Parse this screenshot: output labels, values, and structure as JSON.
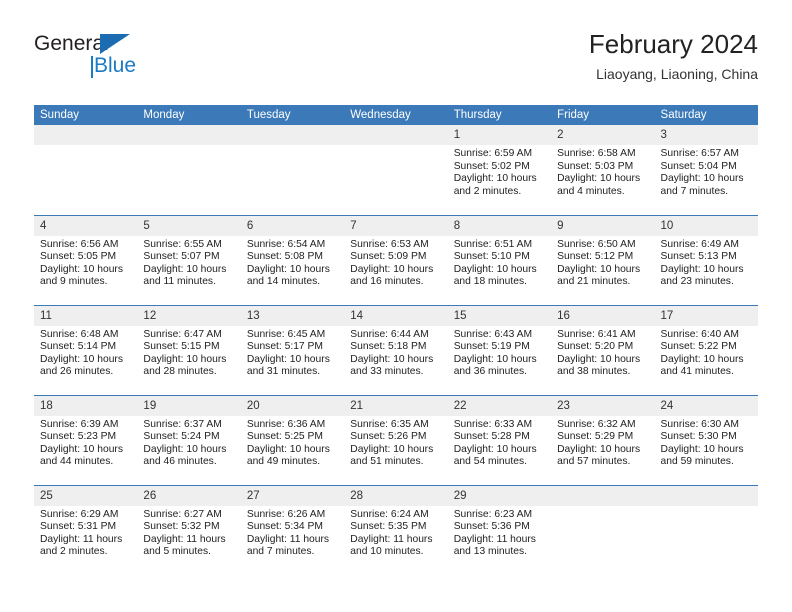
{
  "brand": {
    "name_part1": "General",
    "name_part2": "Blue"
  },
  "header": {
    "title": "February 2024",
    "subtitle": "Liaoyang, Liaoning, China"
  },
  "weekday_headers": [
    "Sunday",
    "Monday",
    "Tuesday",
    "Wednesday",
    "Thursday",
    "Friday",
    "Saturday"
  ],
  "colors": {
    "header_blue": "#3b79b8",
    "day_band_gray": "#efefef",
    "logo_blue": "#1b7cc4",
    "text_dark": "#222222"
  },
  "labels": {
    "sunrise_prefix": "Sunrise:",
    "sunset_prefix": "Sunset:",
    "daylight_prefix": "Daylight:"
  },
  "weeks": [
    [
      {
        "day": "",
        "empty": true
      },
      {
        "day": "",
        "empty": true
      },
      {
        "day": "",
        "empty": true
      },
      {
        "day": "",
        "empty": true
      },
      {
        "day": "1",
        "sunrise": "Sunrise: 6:59 AM",
        "sunset": "Sunset: 5:02 PM",
        "daylight": "Daylight: 10 hours and 2 minutes."
      },
      {
        "day": "2",
        "sunrise": "Sunrise: 6:58 AM",
        "sunset": "Sunset: 5:03 PM",
        "daylight": "Daylight: 10 hours and 4 minutes."
      },
      {
        "day": "3",
        "sunrise": "Sunrise: 6:57 AM",
        "sunset": "Sunset: 5:04 PM",
        "daylight": "Daylight: 10 hours and 7 minutes."
      }
    ],
    [
      {
        "day": "4",
        "sunrise": "Sunrise: 6:56 AM",
        "sunset": "Sunset: 5:05 PM",
        "daylight": "Daylight: 10 hours and 9 minutes."
      },
      {
        "day": "5",
        "sunrise": "Sunrise: 6:55 AM",
        "sunset": "Sunset: 5:07 PM",
        "daylight": "Daylight: 10 hours and 11 minutes."
      },
      {
        "day": "6",
        "sunrise": "Sunrise: 6:54 AM",
        "sunset": "Sunset: 5:08 PM",
        "daylight": "Daylight: 10 hours and 14 minutes."
      },
      {
        "day": "7",
        "sunrise": "Sunrise: 6:53 AM",
        "sunset": "Sunset: 5:09 PM",
        "daylight": "Daylight: 10 hours and 16 minutes."
      },
      {
        "day": "8",
        "sunrise": "Sunrise: 6:51 AM",
        "sunset": "Sunset: 5:10 PM",
        "daylight": "Daylight: 10 hours and 18 minutes."
      },
      {
        "day": "9",
        "sunrise": "Sunrise: 6:50 AM",
        "sunset": "Sunset: 5:12 PM",
        "daylight": "Daylight: 10 hours and 21 minutes."
      },
      {
        "day": "10",
        "sunrise": "Sunrise: 6:49 AM",
        "sunset": "Sunset: 5:13 PM",
        "daylight": "Daylight: 10 hours and 23 minutes."
      }
    ],
    [
      {
        "day": "11",
        "sunrise": "Sunrise: 6:48 AM",
        "sunset": "Sunset: 5:14 PM",
        "daylight": "Daylight: 10 hours and 26 minutes."
      },
      {
        "day": "12",
        "sunrise": "Sunrise: 6:47 AM",
        "sunset": "Sunset: 5:15 PM",
        "daylight": "Daylight: 10 hours and 28 minutes."
      },
      {
        "day": "13",
        "sunrise": "Sunrise: 6:45 AM",
        "sunset": "Sunset: 5:17 PM",
        "daylight": "Daylight: 10 hours and 31 minutes."
      },
      {
        "day": "14",
        "sunrise": "Sunrise: 6:44 AM",
        "sunset": "Sunset: 5:18 PM",
        "daylight": "Daylight: 10 hours and 33 minutes."
      },
      {
        "day": "15",
        "sunrise": "Sunrise: 6:43 AM",
        "sunset": "Sunset: 5:19 PM",
        "daylight": "Daylight: 10 hours and 36 minutes."
      },
      {
        "day": "16",
        "sunrise": "Sunrise: 6:41 AM",
        "sunset": "Sunset: 5:20 PM",
        "daylight": "Daylight: 10 hours and 38 minutes."
      },
      {
        "day": "17",
        "sunrise": "Sunrise: 6:40 AM",
        "sunset": "Sunset: 5:22 PM",
        "daylight": "Daylight: 10 hours and 41 minutes."
      }
    ],
    [
      {
        "day": "18",
        "sunrise": "Sunrise: 6:39 AM",
        "sunset": "Sunset: 5:23 PM",
        "daylight": "Daylight: 10 hours and 44 minutes."
      },
      {
        "day": "19",
        "sunrise": "Sunrise: 6:37 AM",
        "sunset": "Sunset: 5:24 PM",
        "daylight": "Daylight: 10 hours and 46 minutes."
      },
      {
        "day": "20",
        "sunrise": "Sunrise: 6:36 AM",
        "sunset": "Sunset: 5:25 PM",
        "daylight": "Daylight: 10 hours and 49 minutes."
      },
      {
        "day": "21",
        "sunrise": "Sunrise: 6:35 AM",
        "sunset": "Sunset: 5:26 PM",
        "daylight": "Daylight: 10 hours and 51 minutes."
      },
      {
        "day": "22",
        "sunrise": "Sunrise: 6:33 AM",
        "sunset": "Sunset: 5:28 PM",
        "daylight": "Daylight: 10 hours and 54 minutes."
      },
      {
        "day": "23",
        "sunrise": "Sunrise: 6:32 AM",
        "sunset": "Sunset: 5:29 PM",
        "daylight": "Daylight: 10 hours and 57 minutes."
      },
      {
        "day": "24",
        "sunrise": "Sunrise: 6:30 AM",
        "sunset": "Sunset: 5:30 PM",
        "daylight": "Daylight: 10 hours and 59 minutes."
      }
    ],
    [
      {
        "day": "25",
        "sunrise": "Sunrise: 6:29 AM",
        "sunset": "Sunset: 5:31 PM",
        "daylight": "Daylight: 11 hours and 2 minutes."
      },
      {
        "day": "26",
        "sunrise": "Sunrise: 6:27 AM",
        "sunset": "Sunset: 5:32 PM",
        "daylight": "Daylight: 11 hours and 5 minutes."
      },
      {
        "day": "27",
        "sunrise": "Sunrise: 6:26 AM",
        "sunset": "Sunset: 5:34 PM",
        "daylight": "Daylight: 11 hours and 7 minutes."
      },
      {
        "day": "28",
        "sunrise": "Sunrise: 6:24 AM",
        "sunset": "Sunset: 5:35 PM",
        "daylight": "Daylight: 11 hours and 10 minutes."
      },
      {
        "day": "29",
        "sunrise": "Sunrise: 6:23 AM",
        "sunset": "Sunset: 5:36 PM",
        "daylight": "Daylight: 11 hours and 13 minutes."
      },
      {
        "day": "",
        "empty": true
      },
      {
        "day": "",
        "empty": true
      }
    ]
  ]
}
